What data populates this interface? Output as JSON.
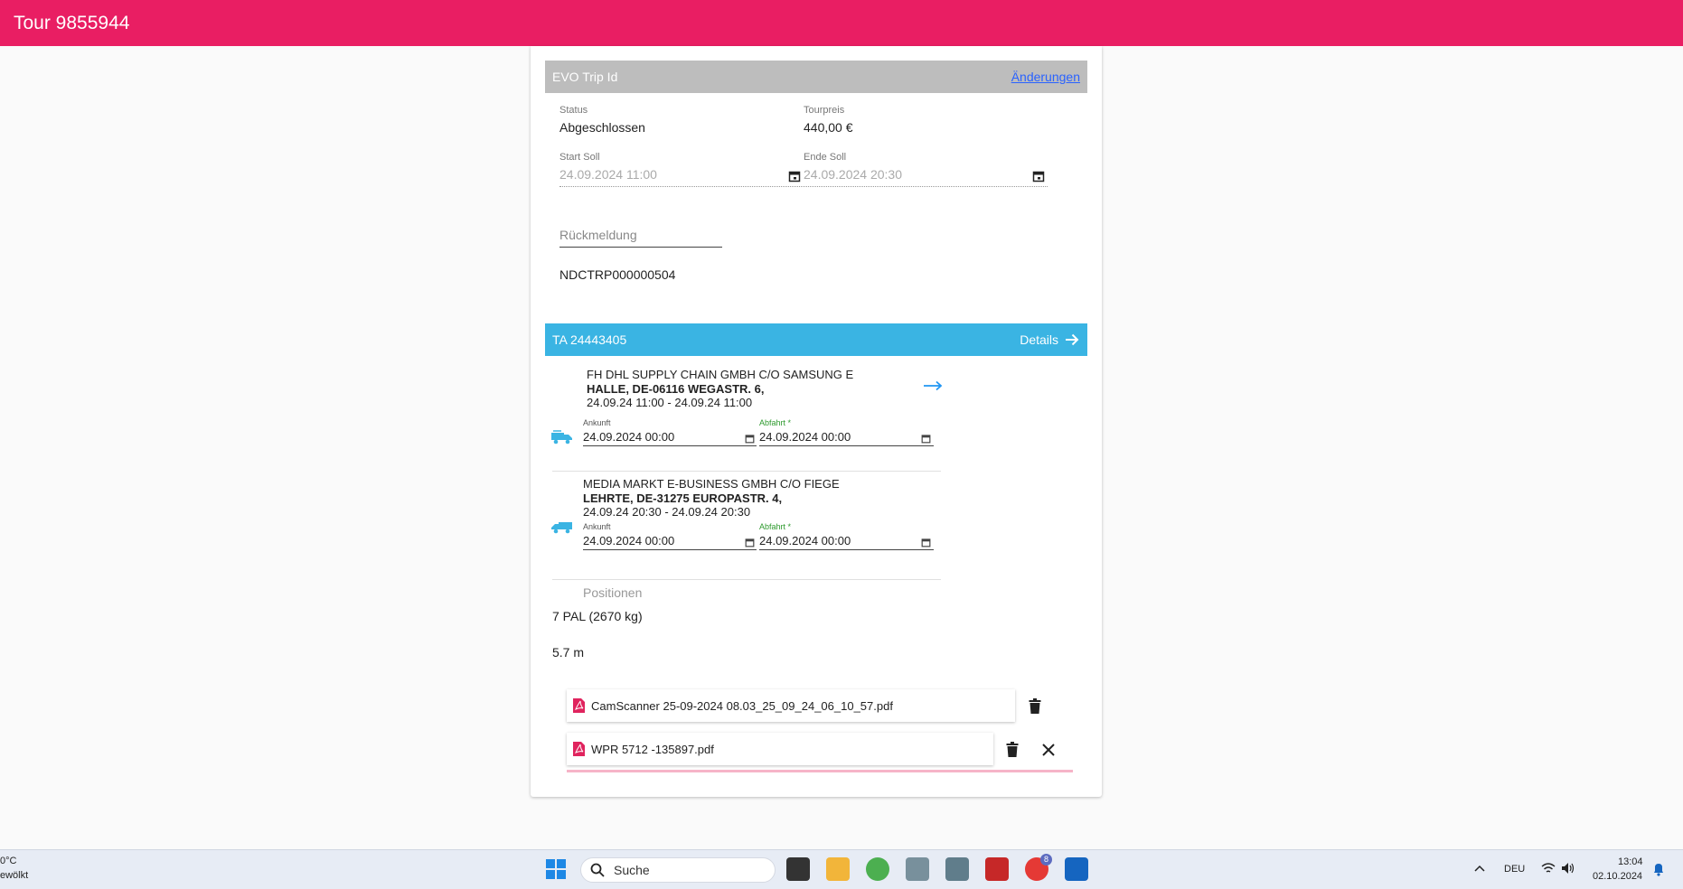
{
  "colors": {
    "appbar": "#e91e63",
    "blue_header": "#3ab4e3",
    "grey_header": "#bdbdbd",
    "pdf_red": "#e0245e"
  },
  "appbar": {
    "title": "Tour 9855944"
  },
  "trip": {
    "header": "EVO Trip Id",
    "changes_link": "Änderungen",
    "status_label": "Status",
    "status_value": "Abgeschlossen",
    "price_label": "Tourpreis",
    "price_value": "440,00 €",
    "start_label": "Start Soll",
    "start_value": "24.09.2024 11:00",
    "end_label": "Ende Soll",
    "end_value": "24.09.2024 20:30",
    "feedback_placeholder": "Rückmeldung",
    "trip_code": "NDCTRP000000504"
  },
  "order": {
    "header": "TA 24443405",
    "details_label": "Details",
    "stops": [
      {
        "name": "FH DHL SUPPLY CHAIN GMBH C/O SAMSUNG E",
        "address": "HALLE, DE-06116 WEGASTR. 6,",
        "window": "24.09.24 11:00 - 24.09.24 11:00",
        "arrival_label": "Ankunft",
        "arrival_value": "24.09.2024 00:00",
        "departure_label": "Abfahrt *",
        "departure_value": "24.09.2024 00:00",
        "icon": "truck-loading-icon"
      },
      {
        "name": "MEDIA MARKT E-BUSINESS GMBH C/O FIEGE",
        "address": "LEHRTE, DE-31275 EUROPASTR. 4,",
        "window": "24.09.24 20:30 - 24.09.24 20:30",
        "arrival_label": "Ankunft",
        "arrival_value": "24.09.2024 00:00",
        "departure_label": "Abfahrt *",
        "departure_value": "24.09.2024 00:00",
        "icon": "truck-unloading-icon"
      }
    ],
    "positions_label": "Positionen",
    "positions_value": "7 PAL (2670 kg)",
    "length_value": "5.7 m",
    "files": [
      {
        "name": "CamScanner 25-09-2024 08.03_25_09_24_06_10_57.pdf"
      },
      {
        "name": "WPR 5712 -135897.pdf"
      }
    ]
  },
  "taskbar": {
    "weather_temp": "0°C",
    "weather_text": "ewölkt",
    "search_label": "Suche",
    "chrome_badge": "8",
    "language": "DEU",
    "time": "13:04",
    "date": "02.10.2024"
  }
}
